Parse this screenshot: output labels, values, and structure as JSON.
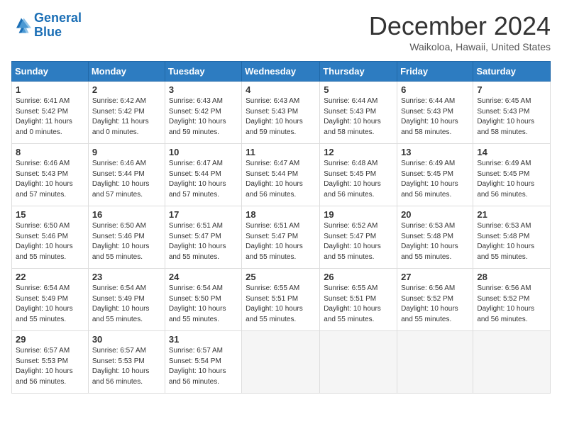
{
  "logo": {
    "line1": "General",
    "line2": "Blue"
  },
  "title": "December 2024",
  "location": "Waikoloa, Hawaii, United States",
  "days_of_week": [
    "Sunday",
    "Monday",
    "Tuesday",
    "Wednesday",
    "Thursday",
    "Friday",
    "Saturday"
  ],
  "weeks": [
    [
      {
        "day": "1",
        "sunrise": "6:41 AM",
        "sunset": "5:42 PM",
        "daylight": "11 hours and 0 minutes."
      },
      {
        "day": "2",
        "sunrise": "6:42 AM",
        "sunset": "5:42 PM",
        "daylight": "11 hours and 0 minutes."
      },
      {
        "day": "3",
        "sunrise": "6:43 AM",
        "sunset": "5:42 PM",
        "daylight": "10 hours and 59 minutes."
      },
      {
        "day": "4",
        "sunrise": "6:43 AM",
        "sunset": "5:43 PM",
        "daylight": "10 hours and 59 minutes."
      },
      {
        "day": "5",
        "sunrise": "6:44 AM",
        "sunset": "5:43 PM",
        "daylight": "10 hours and 58 minutes."
      },
      {
        "day": "6",
        "sunrise": "6:44 AM",
        "sunset": "5:43 PM",
        "daylight": "10 hours and 58 minutes."
      },
      {
        "day": "7",
        "sunrise": "6:45 AM",
        "sunset": "5:43 PM",
        "daylight": "10 hours and 58 minutes."
      }
    ],
    [
      {
        "day": "8",
        "sunrise": "6:46 AM",
        "sunset": "5:43 PM",
        "daylight": "10 hours and 57 minutes."
      },
      {
        "day": "9",
        "sunrise": "6:46 AM",
        "sunset": "5:44 PM",
        "daylight": "10 hours and 57 minutes."
      },
      {
        "day": "10",
        "sunrise": "6:47 AM",
        "sunset": "5:44 PM",
        "daylight": "10 hours and 57 minutes."
      },
      {
        "day": "11",
        "sunrise": "6:47 AM",
        "sunset": "5:44 PM",
        "daylight": "10 hours and 56 minutes."
      },
      {
        "day": "12",
        "sunrise": "6:48 AM",
        "sunset": "5:45 PM",
        "daylight": "10 hours and 56 minutes."
      },
      {
        "day": "13",
        "sunrise": "6:49 AM",
        "sunset": "5:45 PM",
        "daylight": "10 hours and 56 minutes."
      },
      {
        "day": "14",
        "sunrise": "6:49 AM",
        "sunset": "5:45 PM",
        "daylight": "10 hours and 56 minutes."
      }
    ],
    [
      {
        "day": "15",
        "sunrise": "6:50 AM",
        "sunset": "5:46 PM",
        "daylight": "10 hours and 55 minutes."
      },
      {
        "day": "16",
        "sunrise": "6:50 AM",
        "sunset": "5:46 PM",
        "daylight": "10 hours and 55 minutes."
      },
      {
        "day": "17",
        "sunrise": "6:51 AM",
        "sunset": "5:47 PM",
        "daylight": "10 hours and 55 minutes."
      },
      {
        "day": "18",
        "sunrise": "6:51 AM",
        "sunset": "5:47 PM",
        "daylight": "10 hours and 55 minutes."
      },
      {
        "day": "19",
        "sunrise": "6:52 AM",
        "sunset": "5:47 PM",
        "daylight": "10 hours and 55 minutes."
      },
      {
        "day": "20",
        "sunrise": "6:53 AM",
        "sunset": "5:48 PM",
        "daylight": "10 hours and 55 minutes."
      },
      {
        "day": "21",
        "sunrise": "6:53 AM",
        "sunset": "5:48 PM",
        "daylight": "10 hours and 55 minutes."
      }
    ],
    [
      {
        "day": "22",
        "sunrise": "6:54 AM",
        "sunset": "5:49 PM",
        "daylight": "10 hours and 55 minutes."
      },
      {
        "day": "23",
        "sunrise": "6:54 AM",
        "sunset": "5:49 PM",
        "daylight": "10 hours and 55 minutes."
      },
      {
        "day": "24",
        "sunrise": "6:54 AM",
        "sunset": "5:50 PM",
        "daylight": "10 hours and 55 minutes."
      },
      {
        "day": "25",
        "sunrise": "6:55 AM",
        "sunset": "5:51 PM",
        "daylight": "10 hours and 55 minutes."
      },
      {
        "day": "26",
        "sunrise": "6:55 AM",
        "sunset": "5:51 PM",
        "daylight": "10 hours and 55 minutes."
      },
      {
        "day": "27",
        "sunrise": "6:56 AM",
        "sunset": "5:52 PM",
        "daylight": "10 hours and 55 minutes."
      },
      {
        "day": "28",
        "sunrise": "6:56 AM",
        "sunset": "5:52 PM",
        "daylight": "10 hours and 56 minutes."
      }
    ],
    [
      {
        "day": "29",
        "sunrise": "6:57 AM",
        "sunset": "5:53 PM",
        "daylight": "10 hours and 56 minutes."
      },
      {
        "day": "30",
        "sunrise": "6:57 AM",
        "sunset": "5:53 PM",
        "daylight": "10 hours and 56 minutes."
      },
      {
        "day": "31",
        "sunrise": "6:57 AM",
        "sunset": "5:54 PM",
        "daylight": "10 hours and 56 minutes."
      },
      null,
      null,
      null,
      null
    ]
  ]
}
